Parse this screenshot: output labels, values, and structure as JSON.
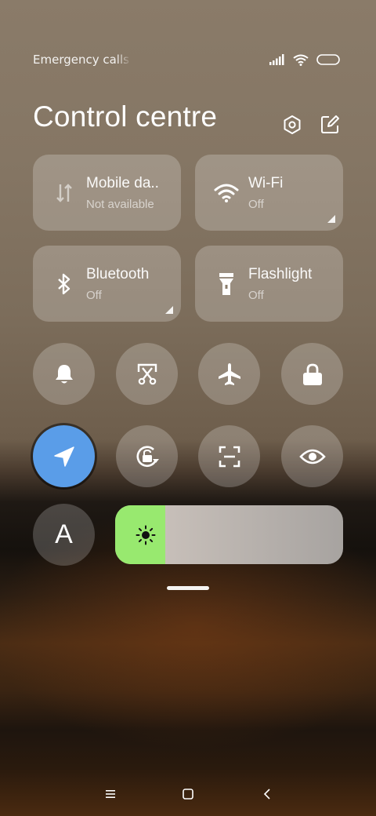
{
  "status_bar": {
    "text": "Emergency calls only",
    "icons": [
      "signal-icon",
      "wifi-icon",
      "battery-icon"
    ]
  },
  "header": {
    "title": "Control centre",
    "icons": [
      "settings-icon",
      "edit-icon"
    ]
  },
  "tiles": [
    {
      "id": "mobile-data",
      "label": "Mobile da..",
      "status": "Not available",
      "icon": "mobile-data-icon"
    },
    {
      "id": "wifi",
      "label": "Wi-Fi",
      "status": "Off",
      "icon": "wifi-icon"
    },
    {
      "id": "bluetooth",
      "label": "Bluetooth",
      "status": "Off",
      "icon": "bluetooth-icon"
    },
    {
      "id": "flashlight",
      "label": "Flashlight",
      "status": "Off",
      "icon": "flashlight-icon"
    }
  ],
  "round_buttons": [
    {
      "id": "silent",
      "icon": "bell-icon",
      "active": false
    },
    {
      "id": "screenshot",
      "icon": "scissors-icon",
      "active": false
    },
    {
      "id": "airplane",
      "icon": "airplane-icon",
      "active": false
    },
    {
      "id": "lock",
      "icon": "lock-icon",
      "active": false
    },
    {
      "id": "location",
      "icon": "location-arrow-icon",
      "active": true
    },
    {
      "id": "rotation",
      "icon": "rotation-lock-icon",
      "active": false
    },
    {
      "id": "scan",
      "icon": "scan-icon",
      "active": false
    },
    {
      "id": "reading",
      "icon": "eye-icon",
      "active": false
    }
  ],
  "font_button": {
    "letter": "A"
  },
  "brightness": {
    "level": 0.22,
    "icon": "brightness-icon"
  },
  "colors": {
    "active_blue": "#5a9de8",
    "brightness_green": "#98e96f"
  },
  "nav": [
    "menu-icon",
    "home-icon",
    "back-icon"
  ]
}
